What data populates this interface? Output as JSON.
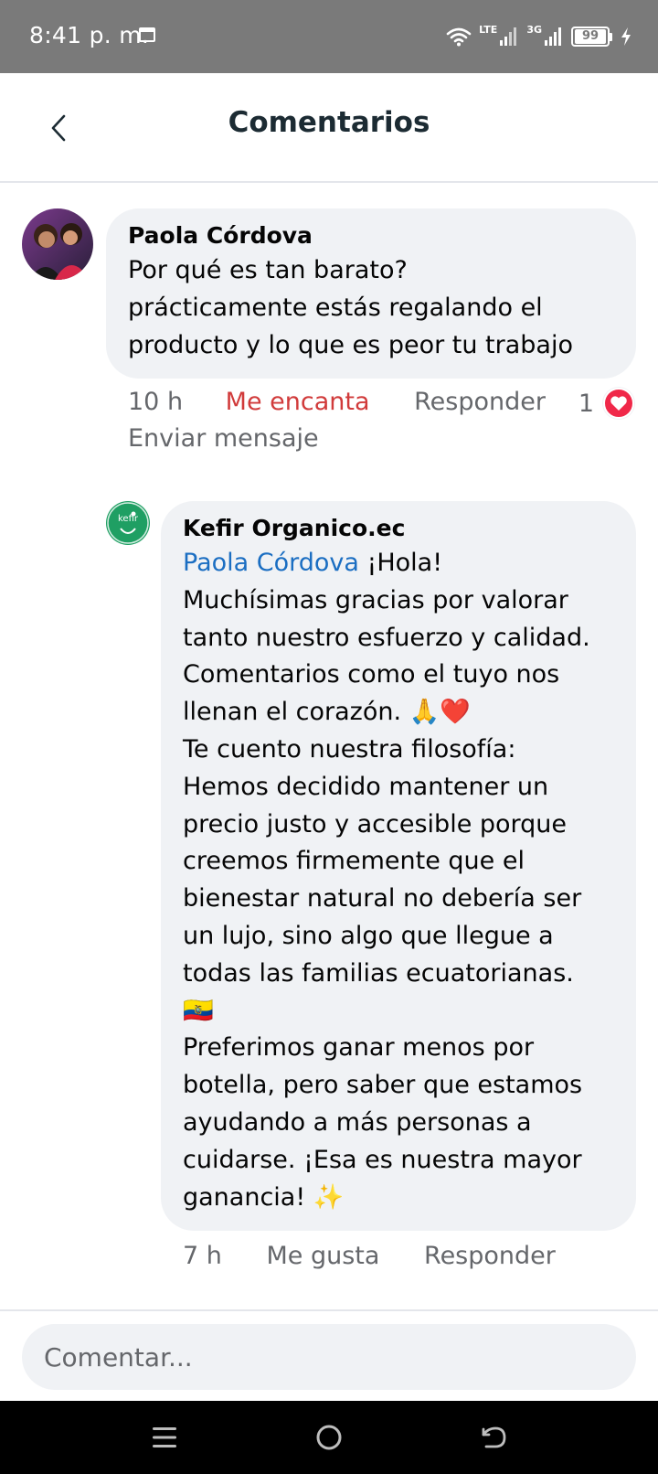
{
  "status_bar": {
    "time": "8:41 p. m.",
    "network_1": "LTE",
    "network_2": "3G",
    "battery": "99"
  },
  "header": {
    "title": "Comentarios"
  },
  "comments": [
    {
      "author": "Paola Córdova",
      "text": "Por qué es tan barato?\nprácticamente estás regalando el\nproducto y lo que es peor tu trabajo",
      "time": "10 h",
      "reaction_label": "Me encanta",
      "reply_label": "Responder",
      "reaction_count": "1",
      "send_message_label": "Enviar mensaje"
    }
  ],
  "reply": {
    "author": "Kefir Organico.ec",
    "mention": "Paola Córdova",
    "text_after_mention": " ¡Hola!\nMuchísimas gracias por valorar\ntanto nuestro esfuerzo y calidad.\nComentarios como el tuyo nos\nllenan el corazón. 🙏❤️\nTe cuento nuestra filosofía:\nHemos decidido mantener un\nprecio justo y accesible porque\ncreemos firmemente que el\nbienestar natural no debería ser\nun lujo, sino algo que llegue a\ntodas las familias ecuatorianas.\n🇪🇨\nPreferimos ganar menos por\nbotella, pero saber que estamos\nayudando a más personas a\ncuidarse. ¡Esa es nuestra mayor\nganancia! ✨",
    "time": "7 h",
    "like_label": "Me gusta",
    "reply_label": "Responder"
  },
  "composer": {
    "placeholder": "Comentar..."
  },
  "colors": {
    "status_bar": "#7a7a7a",
    "bubble": "#f0f2f5",
    "mention": "#1b6ec2",
    "love": "#d13b3b",
    "love_badge": "#f02849",
    "kefir_avatar": "#1f9f63"
  },
  "icons": {
    "back": "chevron-left-icon",
    "wifi": "wifi-icon",
    "battery": "battery-icon",
    "love": "heart-icon",
    "nav_menu": "menu-icon",
    "nav_home": "circle-home-icon",
    "nav_back": "back-arrow-icon"
  }
}
